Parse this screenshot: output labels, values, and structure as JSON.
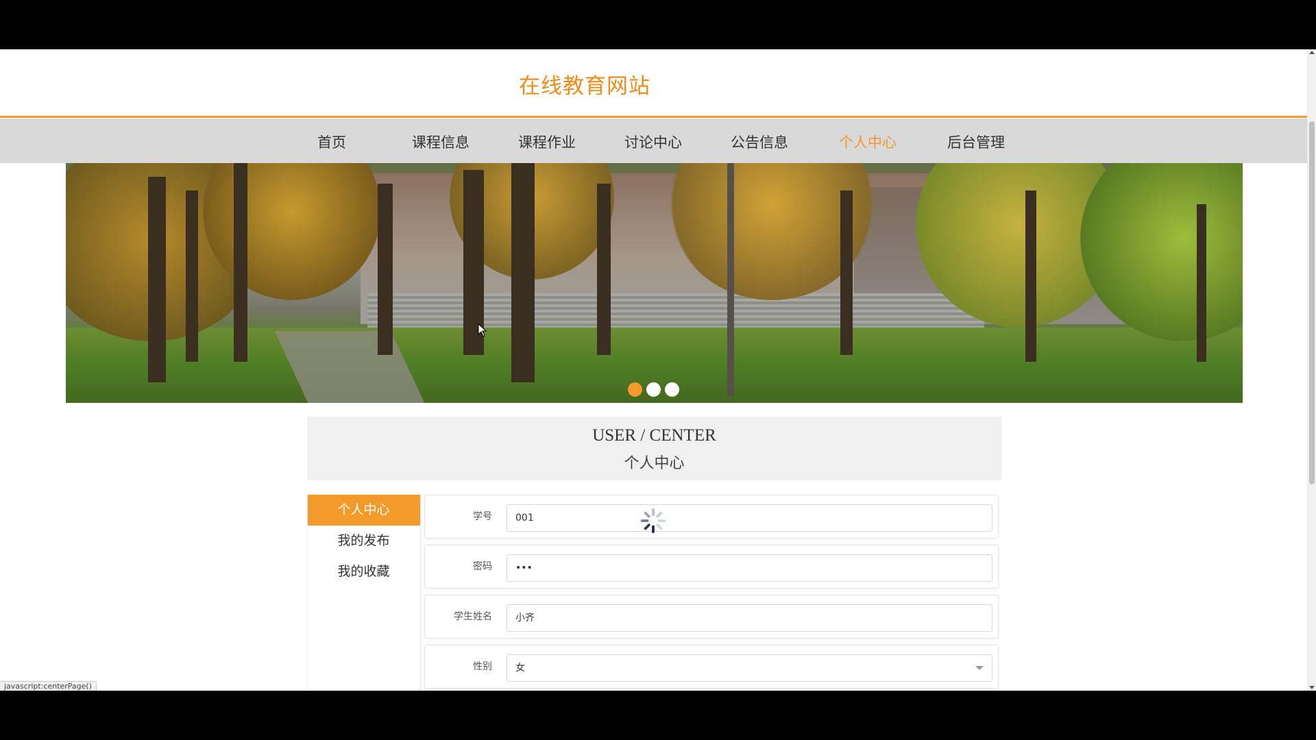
{
  "site": {
    "title": "在线教育网站"
  },
  "nav": {
    "items": [
      {
        "label": "首页",
        "active": false
      },
      {
        "label": "课程信息",
        "active": false
      },
      {
        "label": "课程作业",
        "active": false
      },
      {
        "label": "讨论中心",
        "active": false
      },
      {
        "label": "公告信息",
        "active": false
      },
      {
        "label": "个人中心",
        "active": true
      },
      {
        "label": "后台管理",
        "active": false
      }
    ]
  },
  "banner": {
    "slide_count": 3,
    "active_slide": 1
  },
  "center": {
    "title_en": "USER / CENTER",
    "title_cn": "个人中心"
  },
  "side_menu": {
    "items": [
      {
        "label": "个人中心",
        "active": true
      },
      {
        "label": "我的发布",
        "active": false
      },
      {
        "label": "我的收藏",
        "active": false
      }
    ]
  },
  "form": {
    "student_id": {
      "label": "学号",
      "value": "001"
    },
    "password": {
      "label": "密码",
      "value": "•••"
    },
    "student_name": {
      "label": "学生姓名",
      "value": "小齐"
    },
    "gender": {
      "label": "性别",
      "value": "女"
    }
  },
  "status_bar": {
    "text": "javascript:centerPage()"
  },
  "colors": {
    "accent": "#f39a2b",
    "nav_bg": "#d9d9d9",
    "title_bg": "#f0f0f0"
  }
}
